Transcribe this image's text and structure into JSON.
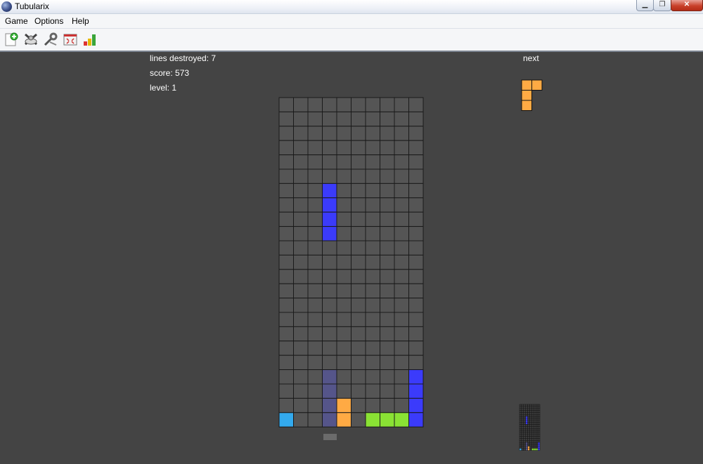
{
  "window": {
    "title": "Tubularix",
    "close_glyph": "✕",
    "minimize_glyph": "▁",
    "restore_glyph": "❐"
  },
  "menu": {
    "items": [
      "Game",
      "Options",
      "Help"
    ]
  },
  "toolbar": {
    "buttons": [
      {
        "name": "new-game-icon"
      },
      {
        "name": "hotseat-icon"
      },
      {
        "name": "settings-icon"
      },
      {
        "name": "fullscreen-icon"
      },
      {
        "name": "high-scores-icon"
      }
    ]
  },
  "hud": {
    "lines_label": "lines destroyed:",
    "lines_value": "7",
    "score_label": "score:",
    "score_value": "573",
    "level_label": "level:",
    "level_value": "1",
    "next_label": "next"
  },
  "colors": {
    "background": "#444444",
    "cell": "#555555",
    "grid_line": "#1a1a1a",
    "blue": "#3b3bfb",
    "cyan": "#33aaee",
    "orange": "#ffaa44",
    "green": "#8ae234",
    "ghost": "#55558a"
  },
  "board": {
    "columns": 10,
    "rows": 23,
    "falling_piece": {
      "type": "I",
      "color": "blue",
      "cells": [
        [
          3,
          6
        ],
        [
          3,
          7
        ],
        [
          3,
          8
        ],
        [
          3,
          9
        ]
      ]
    },
    "settled_cells": [
      {
        "col": 3,
        "row": 19,
        "color": "ghost"
      },
      {
        "col": 3,
        "row": 20,
        "color": "ghost"
      },
      {
        "col": 3,
        "row": 21,
        "color": "ghost"
      },
      {
        "col": 3,
        "row": 22,
        "color": "ghost"
      },
      {
        "col": 9,
        "row": 19,
        "color": "blue"
      },
      {
        "col": 9,
        "row": 20,
        "color": "blue"
      },
      {
        "col": 9,
        "row": 21,
        "color": "blue"
      },
      {
        "col": 9,
        "row": 22,
        "color": "blue"
      },
      {
        "col": 4,
        "row": 21,
        "color": "orange"
      },
      {
        "col": 4,
        "row": 22,
        "color": "orange"
      },
      {
        "col": 0,
        "row": 22,
        "color": "cyan"
      },
      {
        "col": 6,
        "row": 22,
        "color": "green"
      },
      {
        "col": 7,
        "row": 22,
        "color": "green"
      },
      {
        "col": 8,
        "row": 22,
        "color": "green"
      }
    ]
  },
  "next_piece": {
    "type": "J",
    "color": "orange",
    "cells": [
      [
        0,
        0
      ],
      [
        1,
        0
      ],
      [
        0,
        1
      ],
      [
        0,
        2
      ]
    ]
  }
}
